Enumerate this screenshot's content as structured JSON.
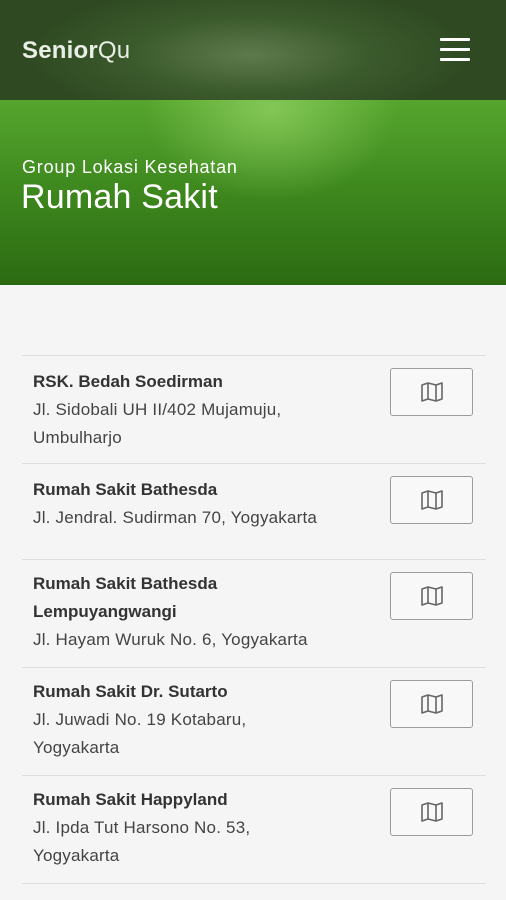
{
  "app": {
    "brand_bold": "Senior",
    "brand_regular": "Qu"
  },
  "hero": {
    "subtitle": "Group Lokasi Kesehatan",
    "title": "Rumah Sakit"
  },
  "hospitals": [
    {
      "name": "RSK. Bedah Soedirman",
      "address_lines": [
        "Jl. Sidobali UH II/402 Mujamuju,",
        "Umbulharjo"
      ]
    },
    {
      "name": "Rumah Sakit Bathesda",
      "address_lines": [
        "Jl. Jendral. Sudirman 70, Yogyakarta"
      ]
    },
    {
      "name_lines": [
        "Rumah Sakit Bathesda",
        "Lempuyangwangi"
      ],
      "address_lines": [
        "Jl. Hayam Wuruk No. 6, Yogyakarta"
      ]
    },
    {
      "name": "Rumah Sakit Dr. Sutarto",
      "address_lines": [
        "Jl. Juwadi No. 19 Kotabaru,",
        "Yogyakarta"
      ]
    },
    {
      "name": "Rumah Sakit Happyland",
      "address_lines": [
        "Jl. Ipda Tut Harsono No. 53,",
        "Yogyakarta"
      ]
    }
  ],
  "icons": {
    "menu": "hamburger-menu-icon",
    "map": "map-icon"
  },
  "colors": {
    "header_dark": "#3b5a2c",
    "hero_green": "#3f8a1f",
    "background": "#f5f5f5"
  }
}
